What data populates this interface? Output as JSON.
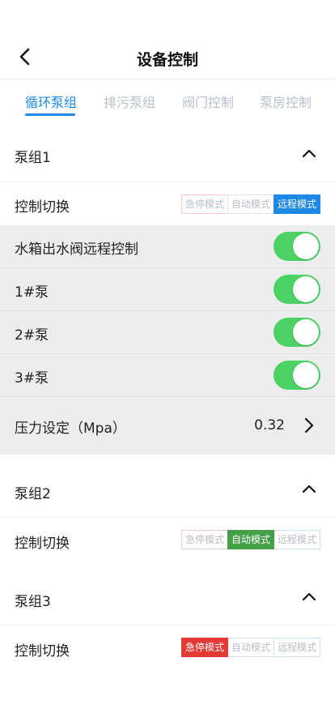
{
  "header": {
    "title": "设备控制"
  },
  "tabs": [
    {
      "label": "循环泵组",
      "active": true
    },
    {
      "label": "排污泵组",
      "active": false
    },
    {
      "label": "阀门控制",
      "active": false
    },
    {
      "label": "泵房控制",
      "active": false
    }
  ],
  "mode_labels": {
    "emergency": "急停模式",
    "auto": "自动模式",
    "remote": "远程模式"
  },
  "groups": [
    {
      "title": "泵组1",
      "switch_label": "控制切换",
      "active_mode": "remote",
      "controls": [
        {
          "label": "水箱出水阀远程控制",
          "on": true
        },
        {
          "label": "1#泵",
          "on": true
        },
        {
          "label": "2#泵",
          "on": true
        },
        {
          "label": "3#泵",
          "on": true
        }
      ],
      "pressure": {
        "label": "压力设定（Mpa）",
        "value": "0.32"
      }
    },
    {
      "title": "泵组2",
      "switch_label": "控制切换",
      "active_mode": "auto"
    },
    {
      "title": "泵组3",
      "switch_label": "控制切换",
      "active_mode": "emergency"
    }
  ],
  "colors": {
    "accent": "#1e88e5",
    "emergency": "#e53935",
    "auto": "#43a047",
    "remote": "#1e88e5",
    "toggle_on": "#4cd264",
    "tab_inactive": "#b7bfcb"
  }
}
